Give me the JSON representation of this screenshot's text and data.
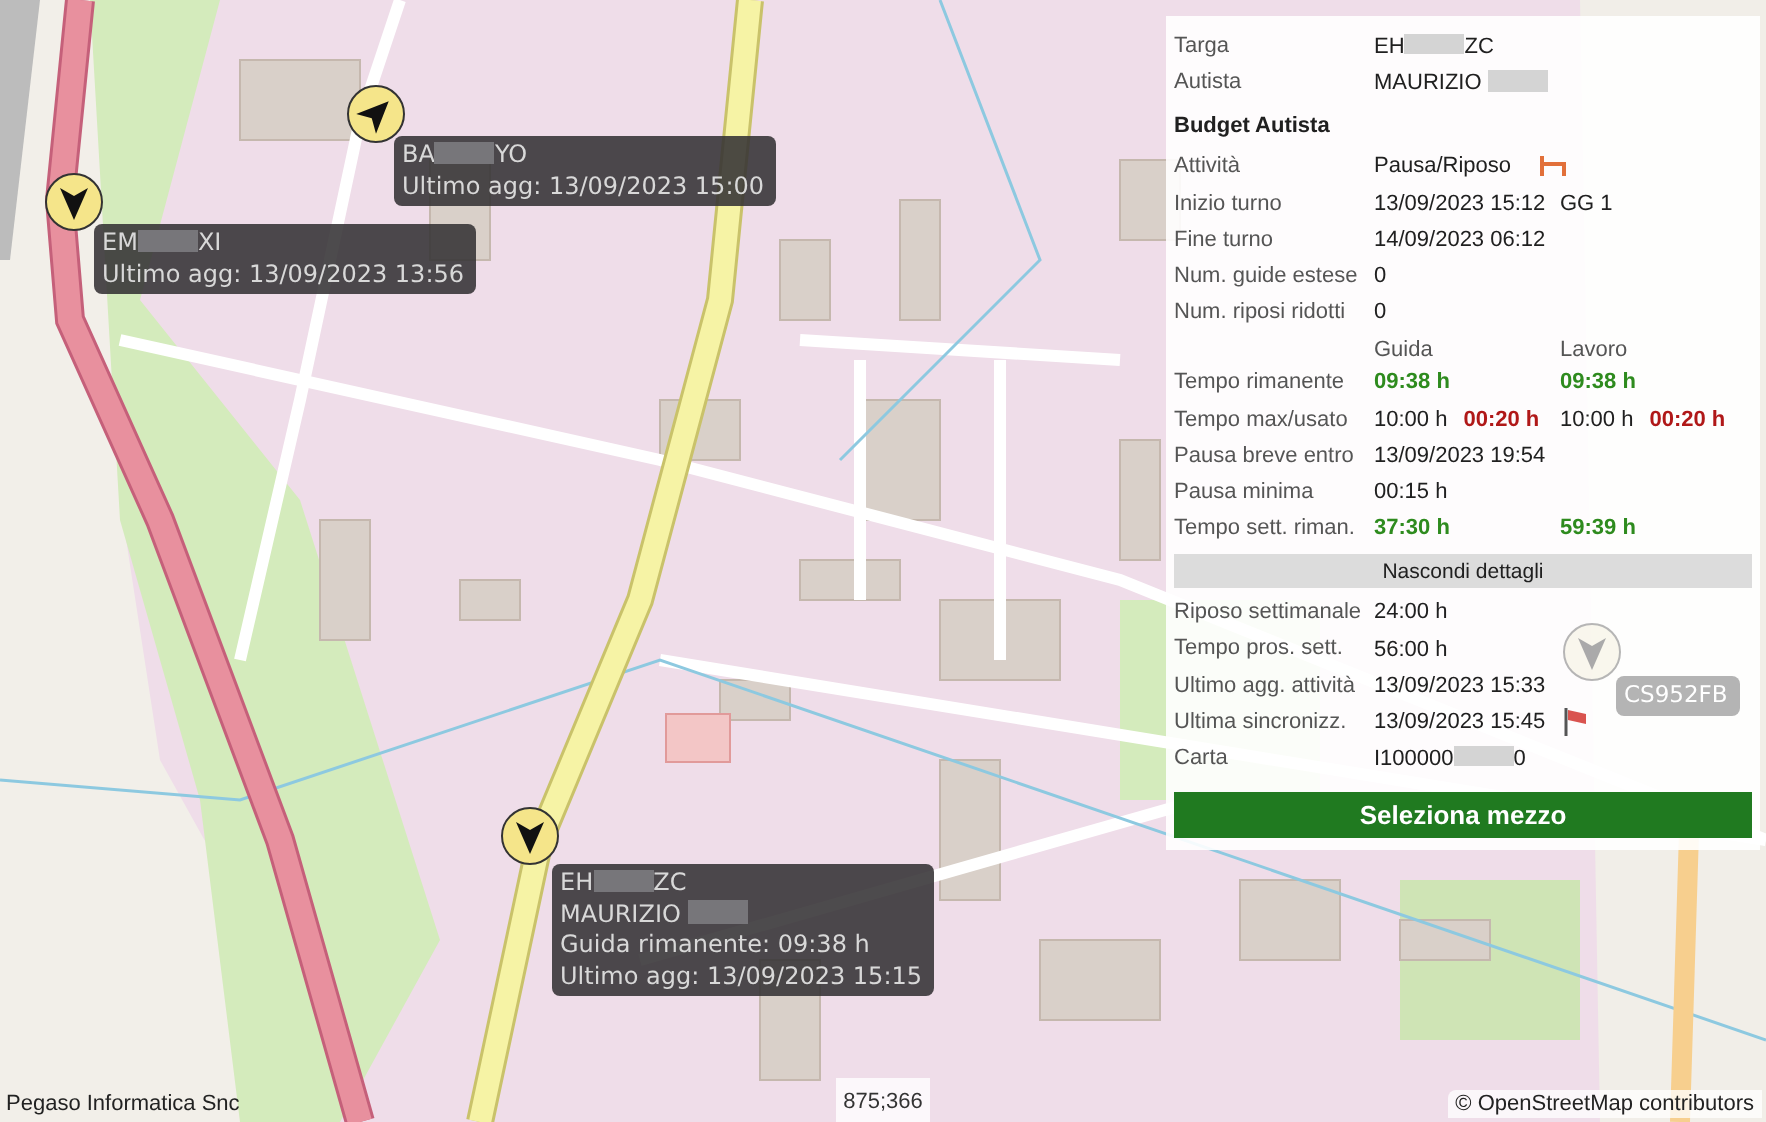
{
  "markers": [
    {
      "faded": false,
      "lines": [
        [
          {
            "text": "BA"
          },
          {
            "kind": "redacted"
          },
          {
            "text": "YO"
          }
        ],
        [
          {
            "text": "Ultimo agg: 13/09/2023 15:00"
          }
        ]
      ]
    },
    {
      "faded": false,
      "lines": [
        [
          {
            "text": "EM"
          },
          {
            "kind": "redacted"
          },
          {
            "text": "XI"
          }
        ],
        [
          {
            "text": "Ultimo agg: 13/09/2023 13:56"
          }
        ]
      ]
    },
    {
      "faded": false,
      "lines": [
        [
          {
            "text": "EH"
          },
          {
            "kind": "redacted"
          },
          {
            "text": "ZC"
          }
        ],
        [
          {
            "text": "MAURIZIO "
          },
          {
            "kind": "redacted"
          }
        ],
        [
          {
            "text": "Guida rimanente: 09:38 h"
          }
        ],
        [
          {
            "text": "Ultimo agg: 13/09/2023 15:15"
          }
        ]
      ]
    },
    {
      "faded": true,
      "lines": [
        [
          {
            "text": "CS952FB"
          }
        ]
      ]
    }
  ],
  "details": {
    "rows": [
      {
        "kind": "field",
        "label": "Targa",
        "cells": [
          [
            {
              "text": "EH"
            },
            {
              "kind": "redacted"
            },
            {
              "text": "ZC"
            }
          ]
        ]
      },
      {
        "kind": "field",
        "label": "Autista",
        "cells": [
          [
            {
              "text": "MAURIZIO "
            },
            {
              "kind": "redacted"
            }
          ]
        ]
      },
      {
        "kind": "title",
        "label": "Budget Autista"
      },
      {
        "kind": "activity",
        "label": "Attività",
        "cells": [
          [
            {
              "text": "Pausa/Riposo"
            }
          ]
        ]
      },
      {
        "kind": "field",
        "label": "Inizio turno",
        "cells": [
          [
            {
              "text": "13/09/2023 15:12"
            }
          ],
          [
            {
              "text": "GG 1"
            }
          ]
        ]
      },
      {
        "kind": "field",
        "label": "Fine turno",
        "cells": [
          [
            {
              "text": "14/09/2023 06:12"
            }
          ]
        ]
      },
      {
        "kind": "field",
        "label": "Num. guide estese",
        "cells": [
          [
            {
              "text": "0"
            }
          ]
        ]
      },
      {
        "kind": "field",
        "label": "Num. riposi ridotti",
        "cells": [
          [
            {
              "text": "0"
            }
          ]
        ]
      },
      {
        "kind": "header",
        "cells": [
          [
            {
              "text": "Guida"
            }
          ],
          [
            {
              "text": "Lavoro"
            }
          ]
        ]
      },
      {
        "kind": "field",
        "label": "Tempo rimanente",
        "cells": [
          [
            {
              "text": "09:38 h",
              "color": "#2e8b1e"
            }
          ],
          [
            {
              "text": "09:38 h",
              "color": "#2e8b1e"
            }
          ]
        ]
      },
      {
        "kind": "field",
        "label": "Tempo max/usato",
        "cells": [
          [
            {
              "text": "10:00 h"
            },
            {
              "text": "00:20 h",
              "color": "#b01818"
            }
          ],
          [
            {
              "text": "10:00 h"
            },
            {
              "text": "00:20 h",
              "color": "#b01818"
            }
          ]
        ]
      },
      {
        "kind": "field",
        "label": "Pausa breve entro",
        "cells": [
          [
            {
              "text": "13/09/2023 19:54"
            }
          ]
        ]
      },
      {
        "kind": "field",
        "label": "Pausa minima",
        "cells": [
          [
            {
              "text": "00:15 h"
            }
          ]
        ]
      },
      {
        "kind": "field",
        "label": "Tempo sett. riman.",
        "cells": [
          [
            {
              "text": "37:30 h",
              "color": "#2e8b1e"
            }
          ],
          [
            {
              "text": "59:39 h",
              "color": "#2e8b1e"
            }
          ]
        ]
      },
      {
        "kind": "toggle",
        "label": "Nascondi dettagli"
      },
      {
        "kind": "field",
        "label": "Riposo settimanale",
        "cells": [
          [
            {
              "text": "24:00 h"
            }
          ]
        ]
      },
      {
        "kind": "field",
        "label": "Tempo pros. sett.",
        "cells": [
          [
            {
              "text": "56:00 h"
            }
          ]
        ]
      },
      {
        "kind": "field",
        "label": "Ultimo agg. attività",
        "cells": [
          [
            {
              "text": "13/09/2023 15:33"
            }
          ]
        ]
      },
      {
        "kind": "sync",
        "label": "Ultima sincronizz.",
        "cells": [
          [
            {
              "text": "13/09/2023 15:45"
            }
          ]
        ]
      },
      {
        "kind": "field",
        "label": "Carta",
        "cells": [
          [
            {
              "text": "I100000"
            },
            {
              "kind": "redacted"
            },
            {
              "text": "0"
            }
          ]
        ]
      }
    ],
    "action": "Seleziona mezzo"
  },
  "footer": {
    "credit": "Pegaso Informatica Snc",
    "coordinates": "875;366",
    "attribution": "© OpenStreetMap contributors"
  }
}
